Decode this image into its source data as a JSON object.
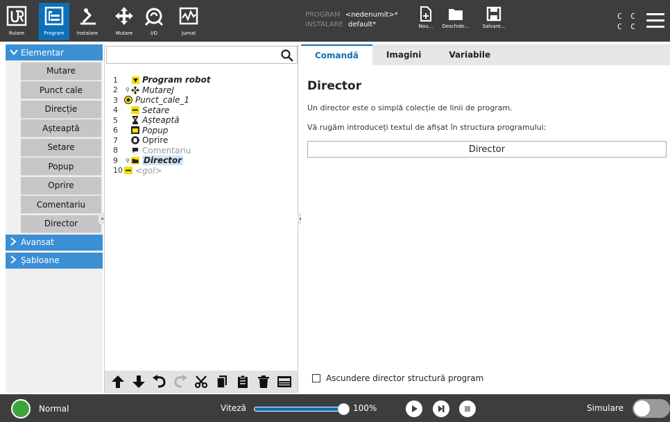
{
  "header": {
    "tabs": [
      {
        "label": "Rulare",
        "icon": "ur-logo-icon"
      },
      {
        "label": "Program",
        "icon": "program-icon",
        "active": true
      },
      {
        "label": "Instalare",
        "icon": "installation-icon"
      }
    ],
    "tools": [
      {
        "label": "Mutare",
        "icon": "move-icon"
      },
      {
        "label": "I/O",
        "icon": "io-icon"
      },
      {
        "label": "Jurnal",
        "icon": "log-icon"
      }
    ],
    "program_key": "PROGRAM",
    "program_value": "<nedenumit>*",
    "installation_key": "INSTALARE",
    "installation_value": "default*",
    "file_buttons": [
      {
        "label": "Nou...",
        "icon": "new-file-icon"
      },
      {
        "label": "Deschide...",
        "icon": "open-folder-icon"
      },
      {
        "label": "Salvare...",
        "icon": "save-icon"
      }
    ],
    "cc_line1": "C C",
    "cc_line2": "C C"
  },
  "sidebar": {
    "categories": [
      {
        "label": "Elementar",
        "expanded": true
      },
      {
        "label": "Avansat",
        "expanded": false
      },
      {
        "label": "Şabloane",
        "expanded": false
      }
    ],
    "items": [
      "Mutare",
      "Punct cale",
      "Direcție",
      "Așteaptă",
      "Setare",
      "Popup",
      "Oprire",
      "Comentariu",
      "Director"
    ]
  },
  "tree": {
    "search_placeholder": "",
    "rows": [
      {
        "num": "1",
        "label": "Program robot"
      },
      {
        "num": "2",
        "label": "MutareJ"
      },
      {
        "num": "3",
        "label": "Punct_cale_1"
      },
      {
        "num": "4",
        "label": "Setare"
      },
      {
        "num": "5",
        "label": "Așteaptă"
      },
      {
        "num": "6",
        "label": "Popup"
      },
      {
        "num": "7",
        "label": "Oprire"
      },
      {
        "num": "8",
        "label": "Comentariu"
      },
      {
        "num": "9",
        "label": "Director"
      },
      {
        "num": "10",
        "label": "<gol>"
      }
    ]
  },
  "right": {
    "tabs": [
      "Comandă",
      "Imagini",
      "Variabile"
    ],
    "title": "Director",
    "description": "Un director este o simplă colecție de linii de program.",
    "prompt": "Vă rugăm introduceți textul de afișat în structura programului:",
    "input_value": "Director",
    "hide_label": "Ascundere director structură program"
  },
  "footer": {
    "status": "Normal",
    "speed_label": "Viteză",
    "speed_value": "100%",
    "speed_fraction": 1.0,
    "sim_label": "Simulare"
  },
  "colors": {
    "accent": "#0d6fb8",
    "category": "#3b8fd4",
    "header_bg": "#3d3d3d",
    "power": "#3ca53c",
    "icon_yellow": "#f4e000"
  }
}
